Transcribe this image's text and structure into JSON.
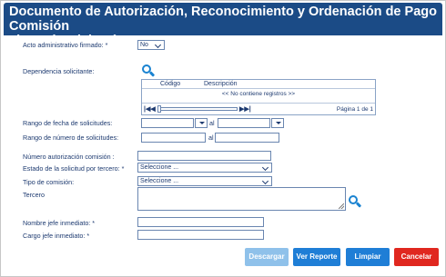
{
  "title": {
    "line1": "Documento de Autorización, Reconocimiento y Ordenación de Pago Comisión",
    "line2": "al Interior del País"
  },
  "form": {
    "acto_label": "Acto administrativo firmado: *",
    "acto_value": "No",
    "dependencia_label": "Dependencia solicitante:",
    "grid": {
      "col_codigo": "Código",
      "col_descripcion": "Descripción",
      "empty_text": "<< No contiene registros >>",
      "page_text": "Página 1 de 1"
    },
    "rango_fecha_label": "Rango de fecha de solicitudes:",
    "rango_fecha_sep": "al",
    "rango_numero_label": "Rango de número de solicitudes:",
    "rango_numero_sep": "al",
    "numero_autorizacion_label": "Número autorización comisión :",
    "estado_label": "Estado de la solicitud por tercero: *",
    "estado_value": "Seleccione ...",
    "tipo_label": "Tipo de comisión:",
    "tipo_value": "Seleccione ...",
    "tercero_label": "Tercero",
    "nombre_jefe_label": "Nombre jefe inmediato: *",
    "cargo_jefe_label": "Cargo jefe inmediato: *"
  },
  "buttons": {
    "descargar": "Descargar",
    "ver_reporte": "Ver Reporte",
    "limpiar": "Limpiar",
    "cancelar": "Cancelar"
  },
  "icons": {
    "dependencia_search": "search-icon",
    "tercero_search": "search-icon"
  },
  "colors": {
    "title_bg": "#1b4b86",
    "label_text": "#1d3a70",
    "primary_button": "#1f7ed6",
    "disabled_button": "#8fc1ea",
    "danger_button": "#e0271f",
    "search_icon": "#1a83d1"
  }
}
